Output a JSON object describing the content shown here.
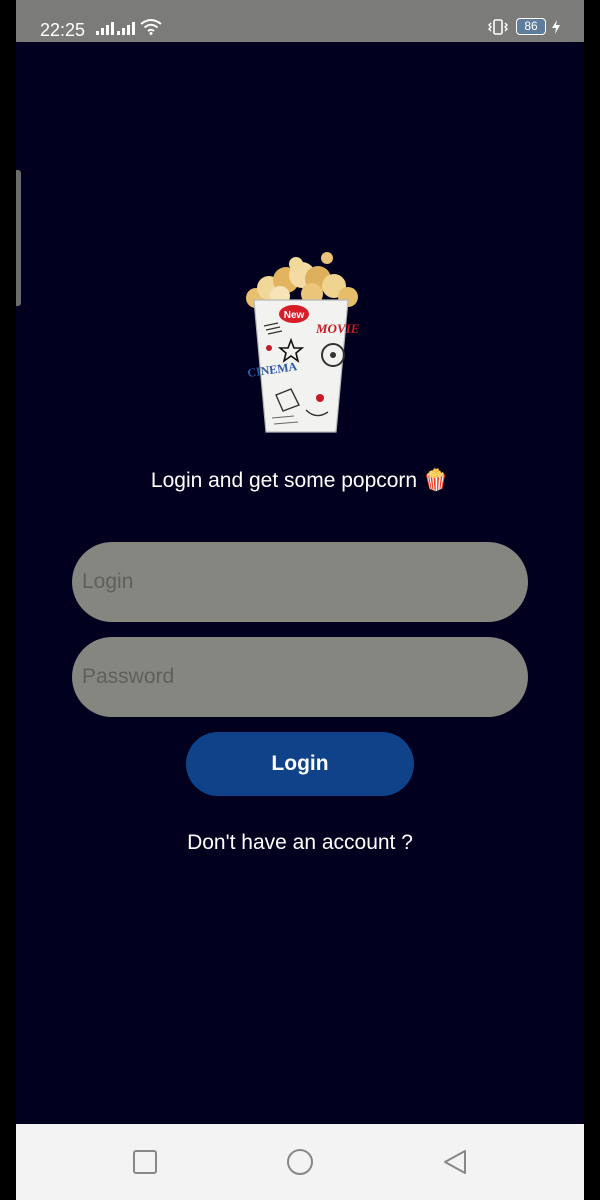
{
  "status_bar": {
    "time": "22:25",
    "battery_level": "86",
    "icons": [
      "signal-icon",
      "signal-icon-2",
      "wifi-icon",
      "vibrate-icon",
      "battery-icon",
      "charging-icon"
    ]
  },
  "login": {
    "tagline": "Login and get some popcorn 🍿",
    "username_placeholder": "Login",
    "password_placeholder": "Password",
    "username_value": "",
    "password_value": "",
    "submit_label": "Login",
    "signup_link": "Don't have an account ?"
  },
  "navigation_bar": {
    "buttons": [
      "recent-apps-button",
      "home-button",
      "back-button"
    ]
  },
  "colors": {
    "background": "#01001f",
    "input": "#868680",
    "button": "#0f4288",
    "status_bar": "#7b7b79"
  }
}
